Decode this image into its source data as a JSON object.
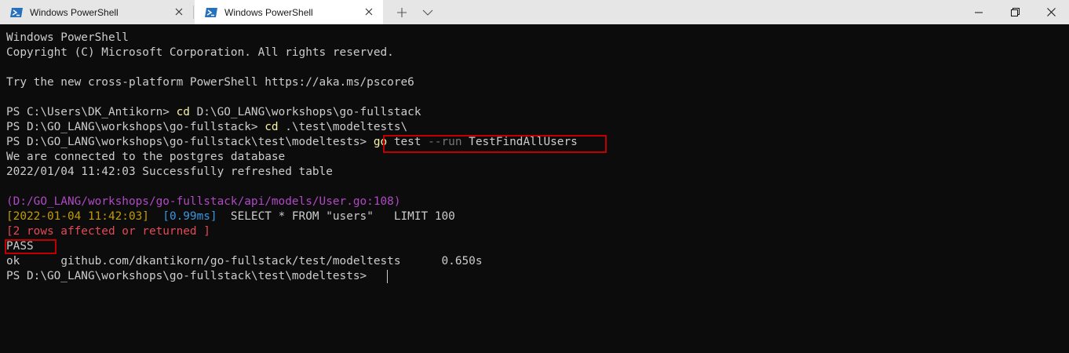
{
  "tabs": [
    {
      "title": "Windows PowerShell",
      "active": false
    },
    {
      "title": "Windows PowerShell",
      "active": true
    }
  ],
  "colors": {
    "titlebar": "#e6e6e6",
    "terminal_bg": "#0c0c0c",
    "terminal_fg": "#cccccc",
    "command_yellow": "#f9f1a5",
    "param_gray": "#767676",
    "path_purple": "#b148c6",
    "timestamp_gold": "#c19c00",
    "duration_cyan": "#3a96dd",
    "rows_red": "#e74856",
    "highlight_red": "#c00000"
  },
  "terminal": {
    "banner_title": "Windows PowerShell",
    "copyright": "Copyright (C) Microsoft Corporation. All rights reserved.",
    "try_new": "Try the new cross-platform PowerShell https://aka.ms/pscore6",
    "cmd1": {
      "prompt": "PS C:\\Users\\DK_Antikorn> ",
      "command": "cd",
      "args": " D:\\GO_LANG\\workshops\\go-fullstack"
    },
    "cmd2": {
      "prompt": "PS D:\\GO_LANG\\workshops\\go-fullstack> ",
      "command": "cd",
      "args": " .\\test\\modeltests\\"
    },
    "cmd3": {
      "prompt": "PS D:\\GO_LANG\\workshops\\go-fullstack\\test\\modeltests> ",
      "command": "go",
      "arg1": " test ",
      "flag": "--run",
      "arg2": " TestFindAllUsers"
    },
    "connected": "We are connected to the postgres database",
    "refreshed": "2022/01/04 11:42:03 Successfully refreshed table",
    "gorm_path": "(D:/GO_LANG/workshops/go-fullstack/api/models/User.go:108)",
    "gorm_time": "[2022-01-04 11:42:03]",
    "gorm_duration": "[0.99ms]",
    "gorm_sql": "SELECT * FROM \"users\"   LIMIT 100",
    "gorm_rows": "[2 rows affected or returned ]",
    "pass": "PASS",
    "ok_status": "ok",
    "ok_package": "github.com/dkantikorn/go-fullstack/test/modeltests",
    "ok_time": "0.650s",
    "final_prompt": "PS D:\\GO_LANG\\workshops\\go-fullstack\\test\\modeltests> "
  }
}
